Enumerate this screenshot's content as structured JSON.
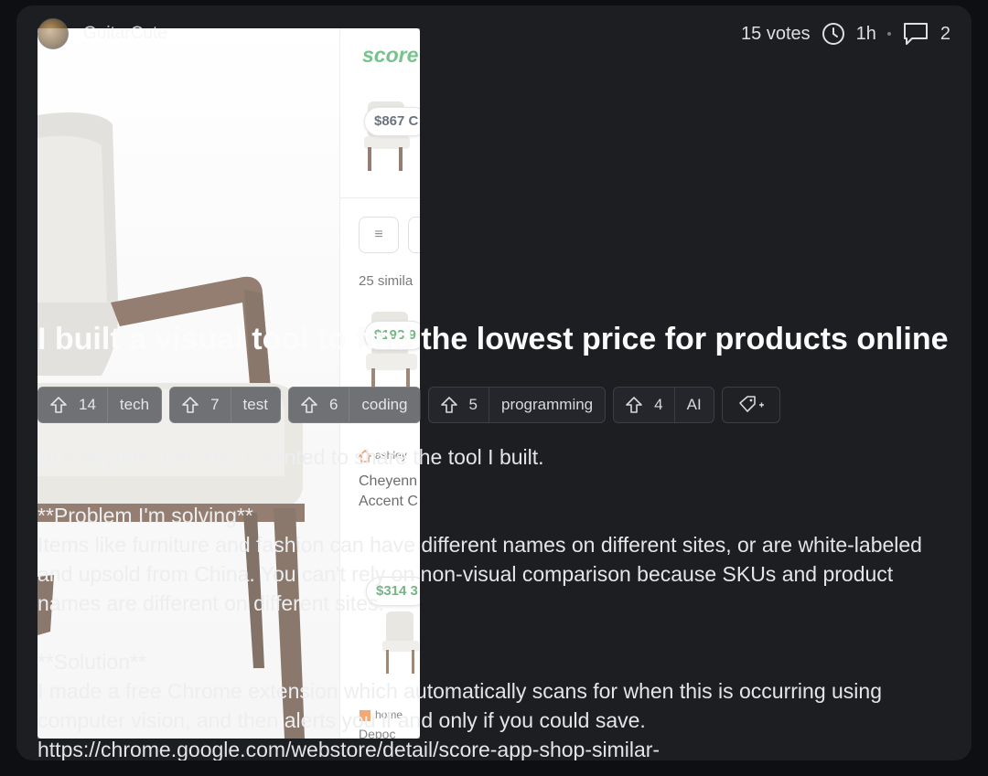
{
  "post": {
    "author": "GuitarCute",
    "votes": "15 votes",
    "time": "1h",
    "comments": "2",
    "title": "I built a visual tool to find the lowest price for products online",
    "tags": [
      {
        "count": "14",
        "label": "tech"
      },
      {
        "count": "7",
        "label": "test"
      },
      {
        "count": "6",
        "label": "coding"
      },
      {
        "count": "5",
        "label": "programming"
      },
      {
        "count": "4",
        "label": "AI"
      }
    ],
    "body": {
      "line1": "Hi everyone from HN! I wanted to share the tool I built.",
      "problem_heading": "**Problem I'm solving**",
      "problem_text": "Items like furniture and fashion can have different names on different sites, or are white-labeled and upsold from China. You can't rely on non-visual comparison because SKUs and product names are different on different sites.",
      "solution_heading": "**Solution**",
      "solution_text": "I made a free Chrome extension which automatically scans for when this is occurring using computer vision, and then alerts you if and only if you could save.",
      "link": "https://chrome.google.com/webstore/detail/score-app-shop-similar-"
    }
  },
  "screenshot": {
    "brand": "score",
    "price1": "$867 C",
    "similar": "25 simila",
    "price2": "$193.9",
    "store1": "ashley",
    "product1_line1": "Cheyenn",
    "product1_line2": "Accent C",
    "price3": "$314 3",
    "store2": "home",
    "store2_sub": "Depoc"
  },
  "colors": {
    "brand_green": "#2fa44f",
    "card_bg": "#1d1e22",
    "page_bg": "#0e0f12"
  }
}
